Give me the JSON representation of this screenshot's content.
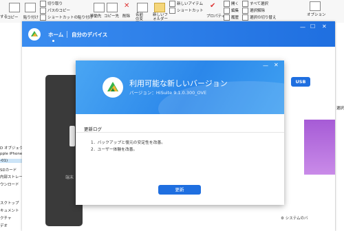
{
  "explorer": {
    "ribbon": {
      "cut": "切り取り",
      "copy_path": "パスのコピー",
      "paste_shortcut": "ショートカットの貼り付け",
      "copy_left": "コピー",
      "paste": "貼り付け",
      "move_to": "移動先",
      "copy_to": "コピー先",
      "delete": "削除",
      "rename": "名前の変更",
      "new_folder": "新しいフォルダー",
      "new_item": "新しいアイテム",
      "shortcut": "ショートカット",
      "properties": "プロパティ",
      "open": "開く",
      "edit": "編集",
      "history": "履歴",
      "select_all": "すべて選択",
      "select_none": "選択解除",
      "invert_select": "選択の切り替え",
      "options": "オプション",
      "left_edge": "する"
    },
    "sidebar": [
      "D オブジェクト",
      "pple iPhone",
      "-01)",
      "SDカード",
      "内部ストレー",
      "ウンロード",
      "スクトップ",
      "キュメント",
      "クチャ",
      "デオ"
    ],
    "right_sidebar": [
      "選択",
      ""
    ]
  },
  "hisuite": {
    "tabs": {
      "home": "ホーム",
      "my_device": "自分のデバイス"
    },
    "usb_label": "USB",
    "phone_text": "端末",
    "system_label": "システムのバ"
  },
  "dialog": {
    "title": "利用可能な新しいバージョン",
    "version": "バージョン：HiSuite 9.1.0.300_OVE",
    "log_heading": "更新ログ",
    "log_items": [
      "1．バックアップと復元の安定性を改善。",
      "2．ユーザー体験を改善。"
    ],
    "update_button": "更新"
  }
}
